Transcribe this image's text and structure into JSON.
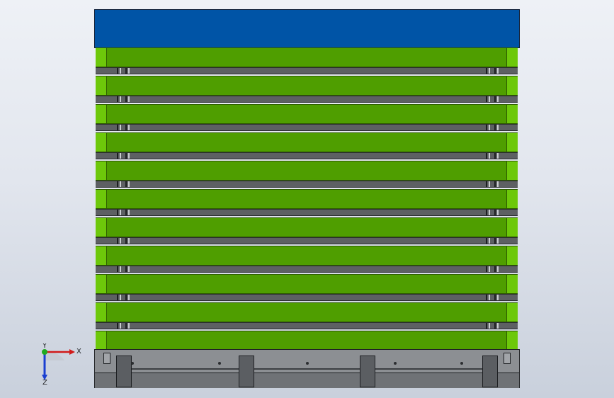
{
  "viewport": {
    "name": "cad-model-view",
    "background_top": "#eef1f6",
    "background_bottom": "#c9d0dc"
  },
  "model": {
    "top_cover_color": "#0054a6",
    "layer_color": "#4f9e00",
    "layer_edge_color": "#6dc80a",
    "rail_color": "#5d6063",
    "base_color": "#8c8f93",
    "layer_count": 11,
    "rail_count": 10
  },
  "triad": {
    "x_label": "X",
    "y_label": "Y",
    "z_label": "Z",
    "x_color": "#d11a1a",
    "y_color": "#1faa1f",
    "z_color": "#1a3fd1"
  }
}
